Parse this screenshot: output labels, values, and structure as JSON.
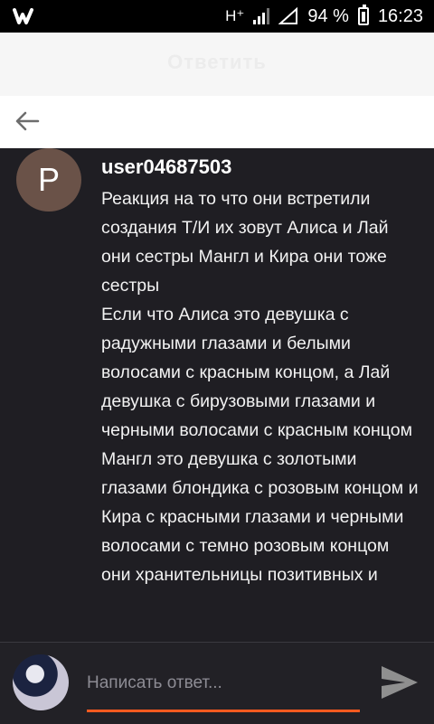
{
  "status_bar": {
    "network": "H⁺",
    "battery": "94 %",
    "time": "16:23"
  },
  "header": {
    "title": "Ответить"
  },
  "comment": {
    "avatar_letter": "P",
    "username": "user04687503",
    "paragraphs": [
      "Реакция на то что они встретили создания Т/И их зовут Алиса и Лай они сестры Мангл и Кира они тоже сестры",
      "Если что Алиса это девушка с радужными глазами и белыми волосами с красным концом, а Лай девушка с бирузовыми глазами и черными волосами с красным концом",
      "Мангл это девушка с золотыми глазами блондика с розовым концом и Кира с красными глазами и черными волосами с темно розовым концом они хранительницы позитивных и"
    ]
  },
  "reply": {
    "placeholder": "Написать ответ..."
  },
  "colors": {
    "accent": "#ff5a1f",
    "background": "#1f1e23",
    "avatar": "#6a5248"
  }
}
